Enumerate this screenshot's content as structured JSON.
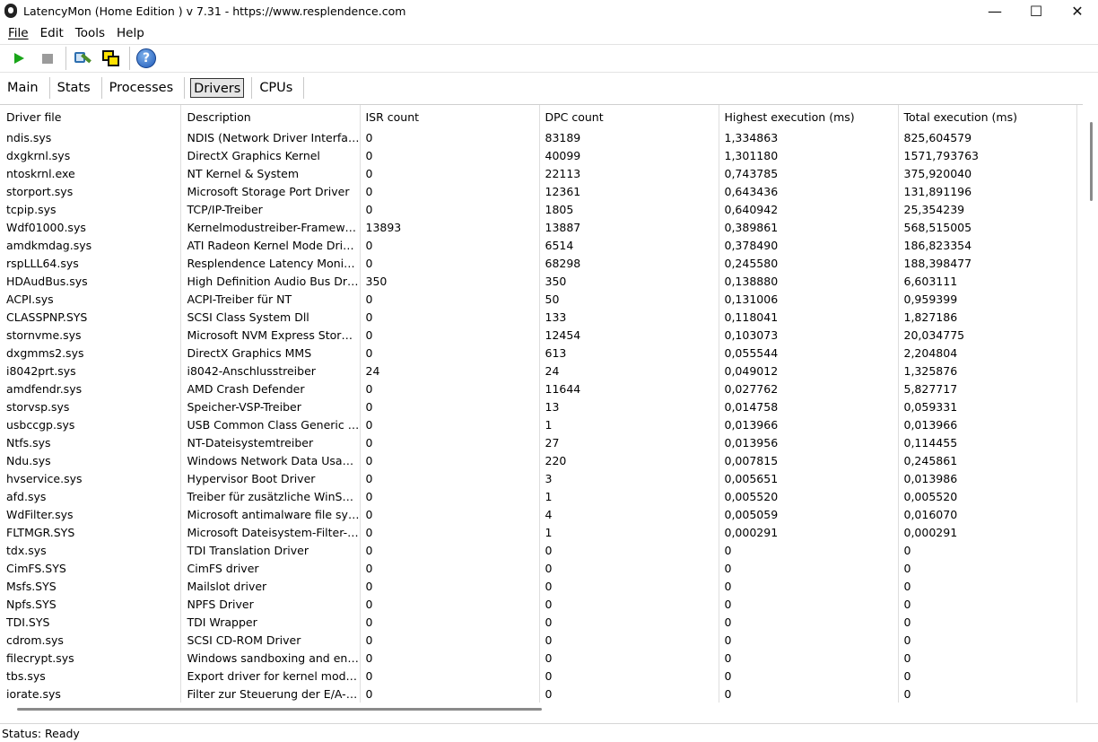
{
  "window": {
    "title": "LatencyMon  (Home Edition )  v 7.31 - https://www.resplendence.com",
    "minimize": "—",
    "maximize": "☐",
    "close": "✕"
  },
  "menu": [
    "File",
    "Edit",
    "Tools",
    "Help"
  ],
  "toolbar": {
    "icons": [
      "play-icon",
      "stop-icon",
      "tools-icon",
      "windows-icon",
      "help-icon"
    ],
    "help_glyph": "?"
  },
  "tabs": [
    {
      "label": "Main",
      "active": false
    },
    {
      "label": "Stats",
      "active": false
    },
    {
      "label": "Processes",
      "active": false
    },
    {
      "label": "Drivers",
      "active": true
    },
    {
      "label": "CPUs",
      "active": false
    }
  ],
  "table": {
    "columns": [
      "Driver file",
      "Description",
      "ISR count",
      "DPC count",
      "Highest execution (ms)",
      "Total execution (ms)"
    ],
    "rows": [
      [
        "ndis.sys",
        "NDIS (Network Driver Interface…",
        "0",
        "83189",
        "1,334863",
        "825,604579"
      ],
      [
        "dxgkrnl.sys",
        "DirectX Graphics Kernel",
        "0",
        "40099",
        "1,301180",
        "1571,793763"
      ],
      [
        "ntoskrnl.exe",
        "NT Kernel & System",
        "0",
        "22113",
        "0,743785",
        "375,920040"
      ],
      [
        "storport.sys",
        "Microsoft Storage Port Driver",
        "0",
        "12361",
        "0,643436",
        "131,891196"
      ],
      [
        "tcpip.sys",
        "TCP/IP-Treiber",
        "0",
        "1805",
        "0,640942",
        "25,354239"
      ],
      [
        "Wdf01000.sys",
        "Kernelmodustreiber-Framewor…",
        "13893",
        "13887",
        "0,389861",
        "568,515005"
      ],
      [
        "amdkmdag.sys",
        "ATI Radeon Kernel Mode Driver",
        "0",
        "6514",
        "0,378490",
        "186,823354"
      ],
      [
        "rspLLL64.sys",
        "Resplendence Latency Monit…",
        "0",
        "68298",
        "0,245580",
        "188,398477"
      ],
      [
        "HDAudBus.sys",
        "High Definition Audio Bus Driver",
        "350",
        "350",
        "0,138880",
        "6,603111"
      ],
      [
        "ACPI.sys",
        "ACPI-Treiber für NT",
        "0",
        "50",
        "0,131006",
        "0,959399"
      ],
      [
        "CLASSPNP.SYS",
        "SCSI Class System Dll",
        "0",
        "133",
        "0,118041",
        "1,827186"
      ],
      [
        "stornvme.sys",
        "Microsoft NVM Express Storp…",
        "0",
        "12454",
        "0,103073",
        "20,034775"
      ],
      [
        "dxgmms2.sys",
        "DirectX Graphics MMS",
        "0",
        "613",
        "0,055544",
        "2,204804"
      ],
      [
        "i8042prt.sys",
        "i8042-Anschlusstreiber",
        "24",
        "24",
        "0,049012",
        "1,325876"
      ],
      [
        "amdfendr.sys",
        "AMD Crash Defender",
        "0",
        "11644",
        "0,027762",
        "5,827717"
      ],
      [
        "storvsp.sys",
        "Speicher-VSP-Treiber",
        "0",
        "13",
        "0,014758",
        "0,059331"
      ],
      [
        "usbccgp.sys",
        "USB Common Class Generic …",
        "0",
        "1",
        "0,013966",
        "0,013966"
      ],
      [
        "Ntfs.sys",
        "NT-Dateisystemtreiber",
        "0",
        "27",
        "0,013956",
        "0,114455"
      ],
      [
        "Ndu.sys",
        "Windows Network Data Usag…",
        "0",
        "220",
        "0,007815",
        "0,245861"
      ],
      [
        "hvservice.sys",
        "Hypervisor Boot Driver",
        "0",
        "3",
        "0,005651",
        "0,013986"
      ],
      [
        "afd.sys",
        "Treiber für zusätzliche WinSo…",
        "0",
        "1",
        "0,005520",
        "0,005520"
      ],
      [
        "WdFilter.sys",
        "Microsoft antimalware file sys…",
        "0",
        "4",
        "0,005059",
        "0,016070"
      ],
      [
        "FLTMGR.SYS",
        "Microsoft Dateisystem-Filter-…",
        "0",
        "1",
        "0,000291",
        "0,000291"
      ],
      [
        "tdx.sys",
        "TDI Translation Driver",
        "0",
        "0",
        "0",
        "0"
      ],
      [
        "CimFS.SYS",
        "CimFS driver",
        "0",
        "0",
        "0",
        "0"
      ],
      [
        "Msfs.SYS",
        "Mailslot driver",
        "0",
        "0",
        "0",
        "0"
      ],
      [
        "Npfs.SYS",
        "NPFS Driver",
        "0",
        "0",
        "0",
        "0"
      ],
      [
        "TDI.SYS",
        "TDI Wrapper",
        "0",
        "0",
        "0",
        "0"
      ],
      [
        "cdrom.sys",
        "SCSI CD-ROM Driver",
        "0",
        "0",
        "0",
        "0"
      ],
      [
        "filecrypt.sys",
        "Windows sandboxing and enc…",
        "0",
        "0",
        "0",
        "0"
      ],
      [
        "tbs.sys",
        "Export driver for kernel mode …",
        "0",
        "0",
        "0",
        "0"
      ],
      [
        "iorate.sys",
        "Filter zur Steuerung der E/A-…",
        "0",
        "0",
        "0",
        "0"
      ]
    ]
  },
  "status": "Status: Ready"
}
